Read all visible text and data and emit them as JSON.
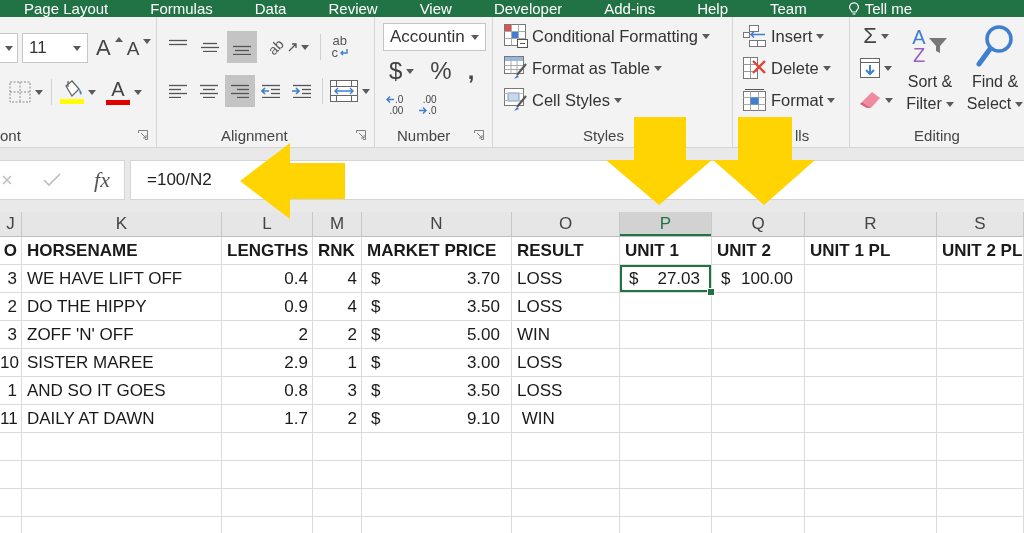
{
  "ribbon_tabs": [
    {
      "kind": "tab",
      "label": "Page Layout",
      "selected": false
    },
    {
      "kind": "tab",
      "label": "Formulas",
      "selected": false
    },
    {
      "kind": "tab",
      "label": "Data",
      "selected": false
    },
    {
      "kind": "tab",
      "label": "Review",
      "selected": false
    },
    {
      "kind": "tab",
      "label": "View",
      "selected": false
    },
    {
      "kind": "tab",
      "label": "Developer",
      "selected": false
    },
    {
      "kind": "tab",
      "label": "Add-ins",
      "selected": false
    },
    {
      "kind": "tab",
      "label": "Help",
      "selected": false
    },
    {
      "kind": "tab",
      "label": "Team",
      "selected": false
    },
    {
      "kind": "search",
      "label": "Tell me",
      "selected": false
    }
  ],
  "font": {
    "size": "11",
    "grow_glyph": "A",
    "shrink_glyph": "A",
    "color_glyph": "A",
    "label": "ont"
  },
  "alignment": {
    "vertical": [
      {
        "kind": "top",
        "selected": false
      },
      {
        "kind": "middle",
        "selected": false
      },
      {
        "kind": "bottom",
        "selected": true
      }
    ],
    "orientation_glyph": "ab",
    "wrap_glyphs": [
      "ab",
      "c"
    ],
    "horizontal": [
      {
        "kind": "left",
        "selected": false
      },
      {
        "kind": "center",
        "selected": false
      },
      {
        "kind": "right",
        "selected": true
      },
      {
        "kind": "decrease",
        "selected": false
      },
      {
        "kind": "increase",
        "selected": false
      }
    ],
    "label": "Alignment"
  },
  "number": {
    "format": "Accountin",
    "currency_glyph": "$",
    "percent_glyph": "%",
    "comma_glyph": ",",
    "decimals": [
      {
        "kind": "increase",
        "top": ".0",
        "bottom": ".00"
      },
      {
        "kind": "decrease",
        "top": ".00",
        "bottom": ".0"
      }
    ],
    "label": "Number"
  },
  "styles": {
    "items": [
      {
        "kind": "conditional",
        "label": "Conditional Formatting"
      },
      {
        "kind": "table",
        "label": "Format as Table"
      },
      {
        "kind": "cell",
        "label": "Cell Styles"
      }
    ],
    "label": "Styles"
  },
  "cells": {
    "items": [
      {
        "kind": "insert",
        "label": "Insert"
      },
      {
        "kind": "delete",
        "label": "Delete"
      },
      {
        "kind": "format",
        "label": "Format"
      }
    ],
    "label": "lls"
  },
  "editing": {
    "tools": [
      {
        "kind": "autosum",
        "glyph": "Σ"
      },
      {
        "kind": "fill"
      },
      {
        "kind": "clear"
      }
    ],
    "sort": {
      "letters": [
        "A",
        "Z"
      ],
      "label": "Sort & Filter"
    },
    "find": {
      "label": "Find & Select"
    },
    "label": "Editing"
  },
  "formula_bar": {
    "fx": "fx",
    "formula": "=100/N2"
  },
  "sheet": {
    "columns": [
      {
        "letter": "J",
        "selected": false
      },
      {
        "letter": "K",
        "selected": false
      },
      {
        "letter": "L",
        "selected": false
      },
      {
        "letter": "M",
        "selected": false
      },
      {
        "letter": "N",
        "selected": false
      },
      {
        "letter": "O",
        "selected": false
      },
      {
        "letter": "P",
        "selected": true
      },
      {
        "letter": "Q",
        "selected": false
      },
      {
        "letter": "R",
        "selected": false
      },
      {
        "letter": "S",
        "selected": false
      }
    ],
    "rows": [
      {
        "kind": "header",
        "cells": [
          {
            "kind": "value",
            "text": "O",
            "selected": false
          },
          {
            "kind": "label",
            "text": "HORSENAME",
            "selected": false
          },
          {
            "kind": "label",
            "text": "LENGTHS",
            "selected": false
          },
          {
            "kind": "label",
            "text": "RNK",
            "selected": false
          },
          {
            "kind": "label",
            "text": "MARKET PRICE",
            "selected": false
          },
          {
            "kind": "label",
            "text": "RESULT",
            "selected": false
          },
          {
            "kind": "label",
            "text": "UNIT 1",
            "selected": false
          },
          {
            "kind": "label",
            "text": "UNIT 2",
            "selected": false
          },
          {
            "kind": "label",
            "text": "UNIT 1 PL",
            "selected": false
          },
          {
            "kind": "label",
            "text": "UNIT 2 PL",
            "selected": false
          }
        ]
      },
      {
        "kind": "data",
        "cells": [
          {
            "kind": "value",
            "text": "3",
            "selected": false
          },
          {
            "kind": "label",
            "text": "WE HAVE LIFT OFF",
            "selected": false
          },
          {
            "kind": "value",
            "text": "0.4",
            "selected": false
          },
          {
            "kind": "value",
            "text": "4",
            "selected": false
          },
          {
            "kind": "money",
            "symbol": "$",
            "amount": "3.70",
            "selected": false
          },
          {
            "kind": "label",
            "text": "LOSS",
            "selected": false
          },
          {
            "kind": "money",
            "symbol": "$",
            "amount": "27.03",
            "selected": true
          },
          {
            "kind": "money",
            "symbol": "$",
            "amount": "100.00",
            "selected": false
          }
        ]
      },
      {
        "kind": "data",
        "cells": [
          {
            "kind": "value",
            "text": "2",
            "selected": false
          },
          {
            "kind": "label",
            "text": "DO THE HIPPY",
            "selected": false
          },
          {
            "kind": "value",
            "text": "0.9",
            "selected": false
          },
          {
            "kind": "value",
            "text": "4",
            "selected": false
          },
          {
            "kind": "money",
            "symbol": "$",
            "amount": "3.50",
            "selected": false
          },
          {
            "kind": "label",
            "text": "LOSS",
            "selected": false
          }
        ]
      },
      {
        "kind": "data",
        "cells": [
          {
            "kind": "value",
            "text": "3",
            "selected": false
          },
          {
            "kind": "label",
            "text": "ZOFF 'N' OFF",
            "selected": false
          },
          {
            "kind": "value",
            "text": "2",
            "selected": false
          },
          {
            "kind": "value",
            "text": "2",
            "selected": false
          },
          {
            "kind": "money",
            "symbol": "$",
            "amount": "5.00",
            "selected": false
          },
          {
            "kind": "label",
            "text": "WIN",
            "selected": false
          }
        ]
      },
      {
        "kind": "data",
        "cells": [
          {
            "kind": "value",
            "text": "10",
            "selected": false
          },
          {
            "kind": "label",
            "text": "SISTER MAREE",
            "selected": false
          },
          {
            "kind": "value",
            "text": "2.9",
            "selected": false
          },
          {
            "kind": "value",
            "text": "1",
            "selected": false
          },
          {
            "kind": "money",
            "symbol": "$",
            "amount": "3.00",
            "selected": false
          },
          {
            "kind": "label",
            "text": "LOSS",
            "selected": false
          }
        ]
      },
      {
        "kind": "data",
        "cells": [
          {
            "kind": "value",
            "text": "1",
            "selected": false
          },
          {
            "kind": "label",
            "text": "AND SO IT GOES",
            "selected": false
          },
          {
            "kind": "value",
            "text": "0.8",
            "selected": false
          },
          {
            "kind": "value",
            "text": "3",
            "selected": false
          },
          {
            "kind": "money",
            "symbol": "$",
            "amount": "3.50",
            "selected": false
          },
          {
            "kind": "label",
            "text": "LOSS",
            "selected": false
          }
        ]
      },
      {
        "kind": "data",
        "cells": [
          {
            "kind": "value",
            "text": "11",
            "selected": false
          },
          {
            "kind": "label",
            "text": "DAILY AT DAWN",
            "selected": false
          },
          {
            "kind": "value",
            "text": "1.7",
            "selected": false
          },
          {
            "kind": "value",
            "text": "2",
            "selected": false
          },
          {
            "kind": "money",
            "symbol": "$",
            "amount": "9.10",
            "selected": false
          },
          {
            "kind": "label",
            "text": " WIN",
            "selected": false
          }
        ]
      }
    ]
  }
}
